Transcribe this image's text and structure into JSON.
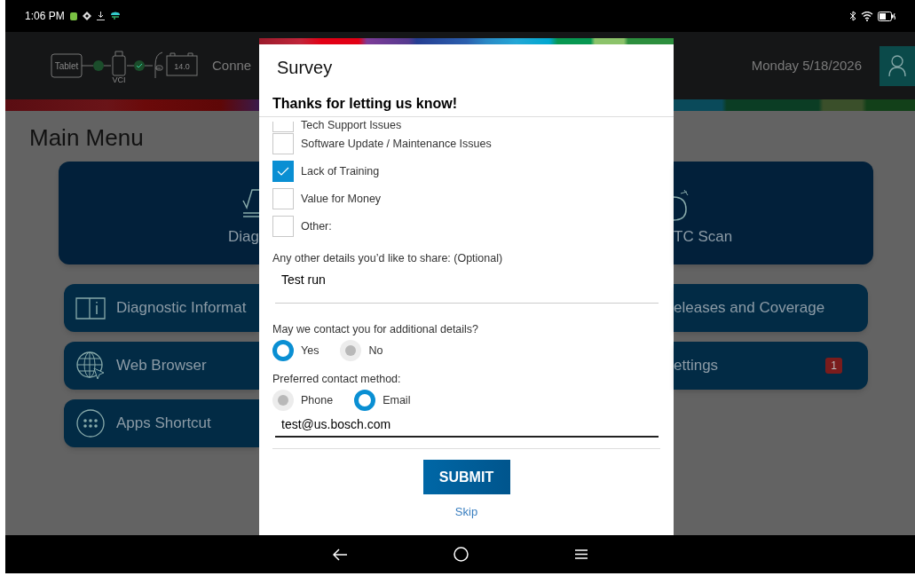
{
  "status_bar": {
    "time": "1:06 PM"
  },
  "header": {
    "tablet": "Tablet",
    "vci": "VCI",
    "battery": "14.0",
    "connection_status": "Conne",
    "date": "Monday 5/18/2026"
  },
  "main_menu": {
    "title": "Main Menu",
    "left": {
      "large_tile": "Diag",
      "tiles": [
        {
          "label": "Diagnostic Informat"
        },
        {
          "label": "Web Browser"
        },
        {
          "label": "Apps Shortcut"
        }
      ]
    },
    "right": {
      "large_tile": "TC Scan",
      "tiles": [
        {
          "label": "eleases and Coverage"
        },
        {
          "label": "ettings",
          "badge": "1"
        }
      ]
    }
  },
  "survey": {
    "title": "Survey",
    "heading": "Thanks for letting us know!",
    "options": [
      {
        "label": "Tech Support Issues",
        "checked": false
      },
      {
        "label": "Software Update / Maintenance Issues",
        "checked": false
      },
      {
        "label": "Lack of Training",
        "checked": true
      },
      {
        "label": "Value for Money",
        "checked": false
      },
      {
        "label": "Other:",
        "checked": false
      }
    ],
    "details_label": "Any other details you’d like to share: (Optional)",
    "details_value": "Test run",
    "contact_question": "May we contact you for additional details?",
    "contact_options": [
      {
        "label": "Yes",
        "selected": true
      },
      {
        "label": "No",
        "selected": false
      }
    ],
    "method_label": "Preferred contact method:",
    "method_options": [
      {
        "label": "Phone",
        "selected": false
      },
      {
        "label": "Email",
        "selected": true
      }
    ],
    "email_value": "test@us.bosch.com",
    "submit": "SUBMIT",
    "skip": "Skip"
  }
}
